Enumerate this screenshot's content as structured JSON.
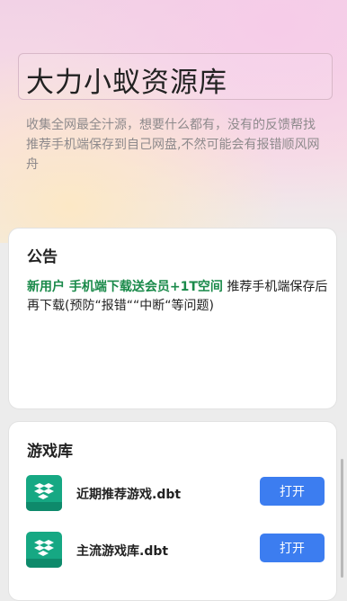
{
  "header": {
    "title": "大力小蚁资源库",
    "subtitle": "收集全网最全汁源，想要什么都有，没有的反馈帮找推荐手机端保存到自己网盘,不然可能会有报错顺风网舟"
  },
  "notice": {
    "title": "公告",
    "highlight": "新用户 手机端下载送会员+1T空间",
    "text": " 推荐手机端保存后再下载(预防“报错““中断“等问题)"
  },
  "games": {
    "title": "游戏库",
    "items": [
      {
        "name": "近期推荐游戏.dbt",
        "button": "打开",
        "icon": "file-icon"
      },
      {
        "name": "主流游戏库.dbt",
        "button": "打开",
        "icon": "file-icon"
      }
    ]
  }
}
